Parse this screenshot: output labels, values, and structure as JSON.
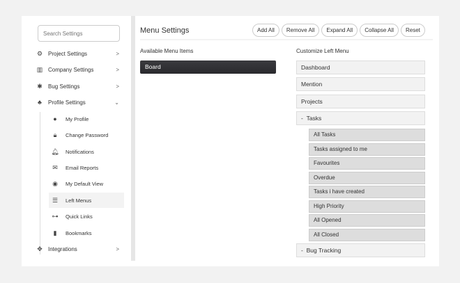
{
  "sidebar": {
    "search_placeholder": "Search Settings",
    "items": [
      {
        "label": "Project Settings",
        "icon": "gear-icon"
      },
      {
        "label": "Company Settings",
        "icon": "building-icon"
      },
      {
        "label": "Bug Settings",
        "icon": "bug-icon"
      },
      {
        "label": "Profile Settings",
        "icon": "user-gear-icon"
      }
    ],
    "sub_items": [
      {
        "label": "My Profile"
      },
      {
        "label": "Change Password"
      },
      {
        "label": "Notifications"
      },
      {
        "label": "Email Reports"
      },
      {
        "label": "My Default View"
      },
      {
        "label": "Left Menus"
      },
      {
        "label": "Quick Links"
      },
      {
        "label": "Bookmarks"
      }
    ],
    "integrations": "Integrations"
  },
  "main": {
    "title": "Menu Settings",
    "buttons": [
      "Add All",
      "Remove All",
      "Expand All",
      "Collapse All",
      "Reset"
    ],
    "available_label": "Available Menu Items",
    "available_items": [
      "Board"
    ],
    "customize_label": "Customize Left Menu",
    "menu": [
      "Dashboard",
      "Mention",
      "Projects"
    ],
    "tasks": "Tasks",
    "expand_marker": "-",
    "task_items": [
      "All Tasks",
      "Tasks assigned to me",
      "Favourites",
      "Overdue",
      "Tasks i have created",
      "High Priority",
      "All Opened",
      "All Closed"
    ],
    "bug_tracking": "Bug Tracking"
  }
}
